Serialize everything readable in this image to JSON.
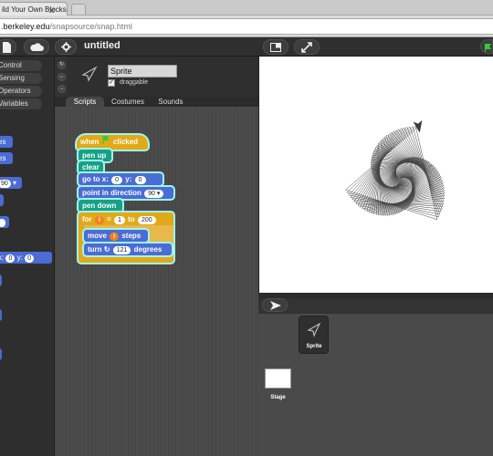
{
  "browser": {
    "tab_title": "ild Your Own Blocks",
    "url_host": ".berkeley.edu",
    "url_path": "/snapsource/snap.html"
  },
  "snap": {
    "project_title": "untitled",
    "categories": [
      "Control",
      "Sensing",
      "Operators",
      "Variables"
    ],
    "palette_blocks": [
      {
        "text": "es",
        "value": ""
      },
      {
        "text": "es",
        "value": ""
      },
      {
        "text": "",
        "value": "90"
      },
      {
        "text": "",
        "value": ""
      },
      {
        "text": "",
        "value": ""
      },
      {
        "text": "x:",
        "value": "0"
      },
      {
        "text": "y:",
        "value": "0"
      }
    ],
    "sprite": {
      "name": "Sprite",
      "draggable_label": "draggable"
    },
    "tabs": [
      "Scripts",
      "Costumes",
      "Sounds"
    ],
    "script": {
      "hat": {
        "prefix": "when",
        "suffix": "clicked"
      },
      "pen_up": "pen up",
      "clear": "clear",
      "goto": {
        "label": "go to x:",
        "x": "0",
        "ylabel": "y:",
        "y": "0"
      },
      "point": {
        "label": "point in direction",
        "value": "90"
      },
      "pen_down": "pen down",
      "for": {
        "label": "for",
        "var": "i",
        "eq": "=",
        "start": "1",
        "to": "to",
        "end": "200"
      },
      "move": {
        "label": "move",
        "var": "i",
        "suffix": "steps"
      },
      "turn": {
        "label": "turn",
        "value": "121",
        "suffix": "degrees"
      }
    },
    "corral": {
      "sprite_label": "Sprite",
      "stage_label": "Stage"
    }
  }
}
